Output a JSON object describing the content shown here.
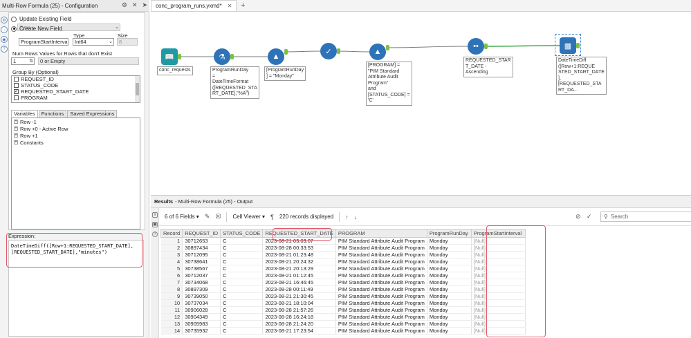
{
  "config": {
    "title": "Multi-Row Formula (25) - Configuration",
    "title_icons": [
      "gear-icon",
      "close-icon",
      "pin-icon"
    ],
    "update_existing_label": "Update Existing Field",
    "update_existing_value": "Type",
    "create_new_label": "Create New  Field",
    "new_field_name": "ProgramStartInterval",
    "type_label": "Type",
    "type_value": "Int64",
    "size_label": "Size",
    "size_value": "8",
    "num_rows_label": "Num Rows",
    "num_rows_value": "1",
    "values_label": "Values for Rows that don't Exist",
    "values_value": "0 or Empty",
    "group_by_label": "Group By (Optional)",
    "group_by_items": [
      {
        "label": "REQUEST_ID",
        "checked": false
      },
      {
        "label": "STATUS_CODE",
        "checked": false
      },
      {
        "label": "REQUESTED_START_DATE",
        "checked": true
      },
      {
        "label": "PROGRAM",
        "checked": false
      }
    ],
    "tabs": [
      "Variables",
      "Functions",
      "Saved Expressions"
    ],
    "tree_items": [
      "Row -1",
      "Row +0 - Active Row",
      "Row +1",
      "Constants"
    ],
    "expression_label": "Expression:",
    "expression_text": "DateTimeDiff([Row+1:REQUESTED_START_DATE],\n[REQUESTED_START_DATE],\"minutes\")"
  },
  "doc_tab": {
    "label": "conc_program_runs.yxmd*"
  },
  "workflow": {
    "annotations": {
      "input": "conc_requests",
      "formula": "ProgramRunDay\n=\nDateTimeFormat\n([REQUESTED_STA\nRT_DATE],\"%A\")",
      "filter1": "[ProgramRunDay\n] = \"Monday\"",
      "filter2": "[PROGRAM] =\n\"PIM Standard\nAttribute Audit\nProgram\"\nand\n[STATUS_CODE] =\n'C'",
      "sort": "REQUESTED_STAR\nT_DATE -\nAscending",
      "multirow": "DateTimeDiff\n([Row+1:REQUE\nSTED_START_DATE\n],\n[REQUESTED_STA\nRT_DA..."
    },
    "colors": {
      "input": "#1f9aa3",
      "formula": "#2e73b8",
      "filter": "#2e73b8",
      "join": "#2e73b8",
      "sort": "#2e73b8",
      "multirow": "#2e73b8",
      "wire": "#7a7a7a",
      "wire_active": "#3fa84c",
      "anchor": "#7cc242"
    }
  },
  "results": {
    "header": "Results",
    "header_sub": "- Multi-Row Formula (25) - Output",
    "fields_label": "6 of 6 Fields",
    "cell_viewer_label": "Cell Viewer",
    "records_label": "220 records displayed",
    "search_placeholder": "Search",
    "columns": [
      "Record",
      "REQUEST_ID",
      "STATUS_CODE",
      "REQUESTED_START_DATE",
      "PROGRAM",
      "ProgramRunDay",
      "ProgramStartInterval"
    ],
    "rows": [
      [
        "1",
        "30712653",
        "C",
        "2023-08-21 03:03:07",
        "PIM Standard Attribute Audit Program",
        "Monday",
        "[Null]"
      ],
      [
        "2",
        "30897434",
        "C",
        "2023-08-28 00:33:53",
        "PIM Standard Attribute Audit Program",
        "Monday",
        "[Null]"
      ],
      [
        "3",
        "30712095",
        "C",
        "2023-08-21 01:23:48",
        "PIM Standard Attribute Audit Program",
        "Monday",
        "[Null]"
      ],
      [
        "4",
        "30738641",
        "C",
        "2023-08-21 20:24:32",
        "PIM Standard Attribute Audit Program",
        "Monday",
        "[Null]"
      ],
      [
        "5",
        "30738567",
        "C",
        "2023-08-21 20:13:29",
        "PIM Standard Attribute Audit Program",
        "Monday",
        "[Null]"
      ],
      [
        "6",
        "30712037",
        "C",
        "2023-08-21 01:12:45",
        "PIM Standard Attribute Audit Program",
        "Monday",
        "[Null]"
      ],
      [
        "7",
        "30734068",
        "C",
        "2023-08-21 16:46:45",
        "PIM Standard Attribute Audit Program",
        "Monday",
        "[Null]"
      ],
      [
        "8",
        "30897309",
        "C",
        "2023-08-28 00:11:49",
        "PIM Standard Attribute Audit Program",
        "Monday",
        "[Null]"
      ],
      [
        "9",
        "30739050",
        "C",
        "2023-08-21 21:30:45",
        "PIM Standard Attribute Audit Program",
        "Monday",
        "[Null]"
      ],
      [
        "10",
        "30737034",
        "C",
        "2023-08-21 18:10:04",
        "PIM Standard Attribute Audit Program",
        "Monday",
        "[Null]"
      ],
      [
        "11",
        "30906028",
        "C",
        "2023-08-28 21:57:26",
        "PIM Standard Attribute Audit Program",
        "Monday",
        "[Null]"
      ],
      [
        "12",
        "30904349",
        "C",
        "2023-08-28 16:24:18",
        "PIM Standard Attribute Audit Program",
        "Monday",
        "[Null]"
      ],
      [
        "13",
        "30905983",
        "C",
        "2023-08-28 21:24:20",
        "PIM Standard Attribute Audit Program",
        "Monday",
        "[Null]"
      ],
      [
        "14",
        "30735932",
        "C",
        "2023-08-21 17:23:54",
        "PIM Standard Attribute Audit Program",
        "Monday",
        "[Null]"
      ]
    ]
  }
}
